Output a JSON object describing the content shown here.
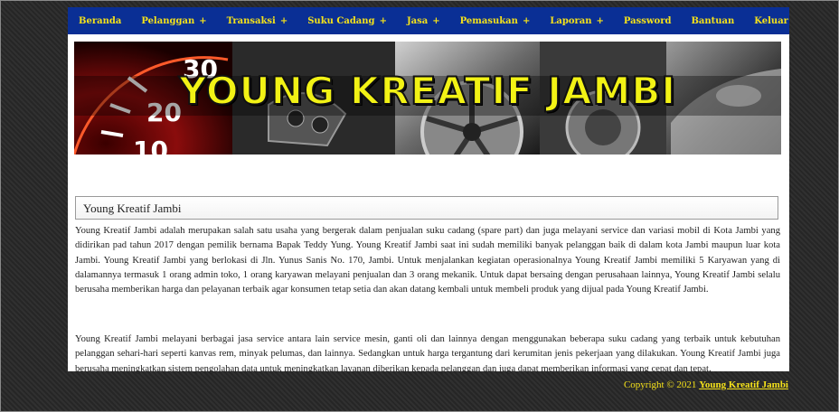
{
  "nav": {
    "items": [
      {
        "label": "Beranda",
        "plus": ""
      },
      {
        "label": "Pelanggan",
        "plus": "+"
      },
      {
        "label": "Transaksi",
        "plus": "+"
      },
      {
        "label": "Suku Cadang",
        "plus": "+"
      },
      {
        "label": "Jasa",
        "plus": "+"
      },
      {
        "label": "Pemasukan",
        "plus": "+"
      },
      {
        "label": "Laporan",
        "plus": "+"
      },
      {
        "label": "Password",
        "plus": ""
      },
      {
        "label": "Bantuan",
        "plus": ""
      },
      {
        "label": "Keluar",
        "plus": ""
      }
    ]
  },
  "banner": {
    "title": "YOUNG KREATIF JAMBI",
    "speedometer_numbers": [
      "30",
      "20",
      "10"
    ]
  },
  "section": {
    "title": "Young Kreatif Jambi",
    "paragraph1": "Young Kreatif Jambi adalah merupakan salah satu usaha yang bergerak dalam penjualan suku cadang (spare part) dan juga melayani service dan variasi mobil di Kota Jambi yang didirikan pad tahun 2017 dengan pemilik bernama Bapak Teddy Yung. Young Kreatif Jambi saat ini sudah memiliki banyak pelanggan baik di dalam kota Jambi maupun luar kota Jambi. Young Kreatif Jambi yang berlokasi di Jln. Yunus Sanis No. 170, Jambi. Untuk menjalankan kegiatan operasionalnya Young Kreatif Jambi memiliki 5 Karyawan yang di dalamannya termasuk 1 orang admin toko, 1 orang karyawan melayani penjualan dan 3 orang mekanik. Untuk dapat bersaing dengan perusahaan lainnya, Young Kreatif Jambi selalu berusaha memberikan harga dan pelayanan terbaik agar konsumen tetap setia dan akan datang kembali untuk membeli produk yang dijual pada Young Kreatif Jambi.",
    "paragraph2": "Young Kreatif Jambi melayani berbagai jasa service antara lain service mesin, ganti oli dan lainnya dengan menggunakan beberapa suku cadang yang terbaik untuk kebutuhan pelanggan sehari-hari seperti kanvas rem, minyak pelumas, dan lainnya. Sedangkan untuk harga tergantung dari kerumitan jenis pekerjaan yang dilakukan. Young Kreatif Jambi juga berusaha meningkatkan sistem pengolahan data untuk meningkatkan layanan diberikan kepada pelanggan dan juga dapat memberikan informasi yang cepat dan tepat."
  },
  "footer": {
    "copyright": "Copyright © 2021",
    "link": "Young Kreatif Jambi"
  },
  "colors": {
    "nav_bg": "#0a2f95",
    "nav_text": "#f5e21a",
    "title_yellow": "#f2f215",
    "background": "#2b2b2b"
  }
}
